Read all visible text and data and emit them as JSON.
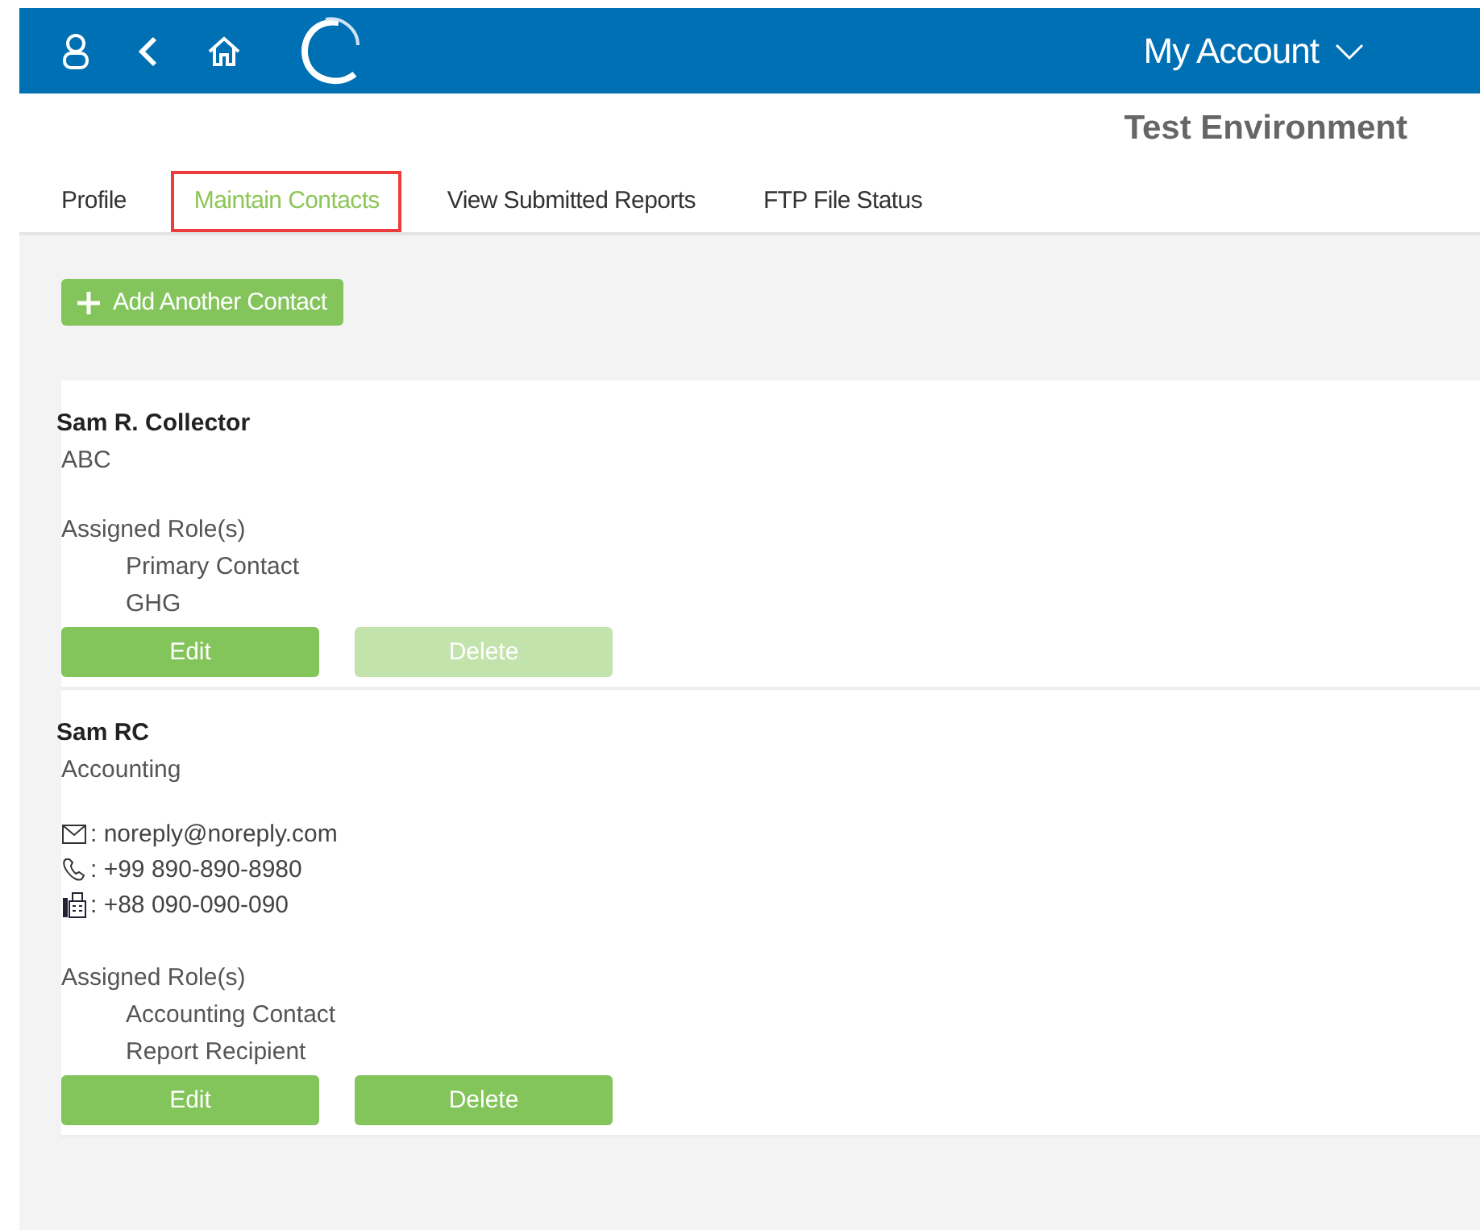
{
  "header": {
    "account_menu": "My Account"
  },
  "environment": "Test Environment",
  "tabs": [
    {
      "label": "Profile",
      "selected": false
    },
    {
      "label": "Maintain Contacts",
      "selected": true
    },
    {
      "label": "View Submitted Reports",
      "selected": false
    },
    {
      "label": "FTP File Status",
      "selected": false
    }
  ],
  "add_button": "Add Another Contact",
  "contacts": [
    {
      "name": "Sam R. Collector",
      "organization": "ABC",
      "roles_label": "Assigned Role(s)",
      "roles": [
        "Primary Contact",
        "GHG"
      ],
      "edit": {
        "label": "Edit",
        "disabled": false
      },
      "delete": {
        "label": "Delete",
        "disabled": true
      }
    },
    {
      "name": "Sam RC",
      "organization": "Accounting",
      "details": [
        {
          "kind": "email",
          "text": ": noreply@noreply.com"
        },
        {
          "kind": "phone",
          "text": ": +99 890-890-8980"
        },
        {
          "kind": "fax",
          "text": ": +88 090-090-090"
        }
      ],
      "roles_label": "Assigned Role(s)",
      "roles": [
        "Accounting Contact",
        "Report Recipient"
      ],
      "edit": {
        "label": "Edit",
        "disabled": false
      },
      "delete": {
        "label": "Delete",
        "disabled": false
      }
    }
  ]
}
